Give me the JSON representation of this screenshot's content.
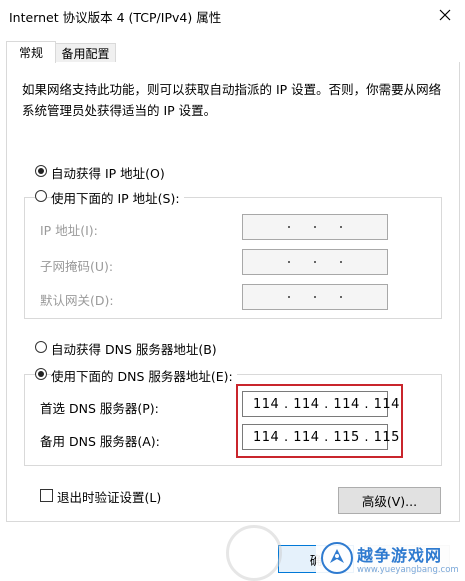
{
  "window": {
    "title": "Internet 协议版本 4 (TCP/IPv4) 属性",
    "close_glyph": "✕"
  },
  "tabs": [
    {
      "label": "常规",
      "selected": true
    },
    {
      "label": "备用配置",
      "selected": false
    }
  ],
  "description": "如果网络支持此功能，则可以获取自动指派的 IP 设置。否则，你需要从网络系统管理员处获得适当的 IP 设置。",
  "ip_section": {
    "auto_option": {
      "label": "自动获得 IP 地址(O)",
      "selected": true
    },
    "manual_option": {
      "label": "使用下面的 IP 地址(S):",
      "selected": false
    },
    "fields": [
      {
        "label": "IP 地址(I):",
        "value": ". . ."
      },
      {
        "label": "子网掩码(U):",
        "value": ". . ."
      },
      {
        "label": "默认网关(D):",
        "value": ". . ."
      }
    ]
  },
  "dns_section": {
    "auto_option": {
      "label": "自动获得 DNS 服务器地址(B)",
      "selected": false
    },
    "manual_option": {
      "label": "使用下面的 DNS 服务器地址(E):",
      "selected": true
    },
    "preferred": {
      "label": "首选 DNS 服务器(P):",
      "value": "114 . 114 . 114 . 114"
    },
    "alternate": {
      "label": "备用 DNS 服务器(A):",
      "value": "114 . 114 . 115 . 115"
    },
    "highlight_color": "#c9252c"
  },
  "validate_on_exit": {
    "label": "退出时验证设置(L)",
    "checked": false
  },
  "buttons": {
    "advanced": "高级(V)...",
    "ok": "确",
    "cancel": ""
  },
  "watermark": {
    "title": "越争游戏网",
    "url": "www.yueyangbang.com"
  },
  "colors": {
    "accent": "#0078d7",
    "border": "#d9d9d9",
    "disabled_text": "#9a9a9a"
  }
}
